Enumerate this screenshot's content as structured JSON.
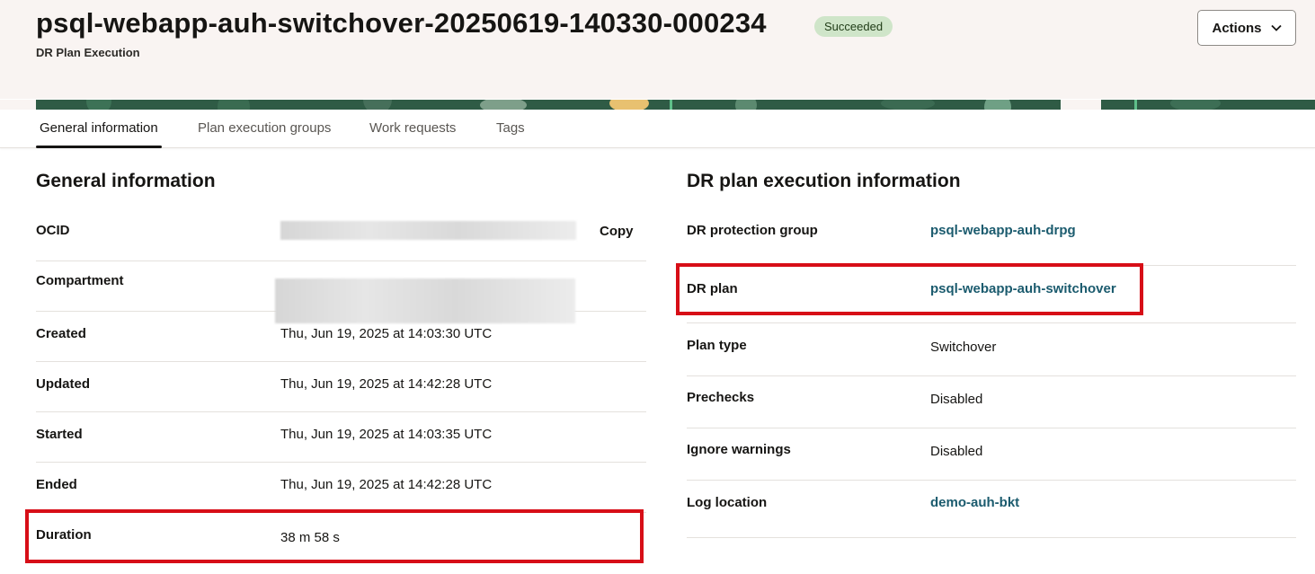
{
  "header": {
    "title": "psql-webapp-auh-switchover-20250619-140330-000234",
    "status_badge": "Succeeded",
    "subtitle": "DR Plan Execution",
    "actions_label": "Actions"
  },
  "tabs": [
    {
      "label": "General information",
      "active": true
    },
    {
      "label": "Plan execution groups",
      "active": false
    },
    {
      "label": "Work requests",
      "active": false
    },
    {
      "label": "Tags",
      "active": false
    }
  ],
  "general": {
    "heading": "General information",
    "copy_label": "Copy",
    "rows": [
      {
        "label": "OCID",
        "value": ""
      },
      {
        "label": "Compartment",
        "value": ""
      },
      {
        "label": "Created",
        "value": "Thu, Jun 19, 2025 at 14:03:30 UTC"
      },
      {
        "label": "Updated",
        "value": "Thu, Jun 19, 2025 at 14:42:28 UTC"
      },
      {
        "label": "Started",
        "value": "Thu, Jun 19, 2025 at 14:03:35 UTC"
      },
      {
        "label": "Ended",
        "value": "Thu, Jun 19, 2025 at 14:42:28 UTC"
      },
      {
        "label": "Duration",
        "value": "38 m 58 s"
      }
    ]
  },
  "execution": {
    "heading": "DR plan execution information",
    "rows": [
      {
        "label": "DR protection group",
        "value": "psql-webapp-auh-drpg"
      },
      {
        "label": "DR plan",
        "value": "psql-webapp-auh-switchover"
      },
      {
        "label": "Plan type",
        "value": "Switchover"
      },
      {
        "label": "Prechecks",
        "value": "Disabled"
      },
      {
        "label": "Ignore warnings",
        "value": "Disabled"
      },
      {
        "label": "Log location",
        "value": "demo-auh-bkt"
      }
    ]
  },
  "colors": {
    "highlight": "#d70e17",
    "link": "#1b5b6e",
    "badge_bg": "#cfe5c9",
    "header_bg": "#f9f4f2"
  }
}
